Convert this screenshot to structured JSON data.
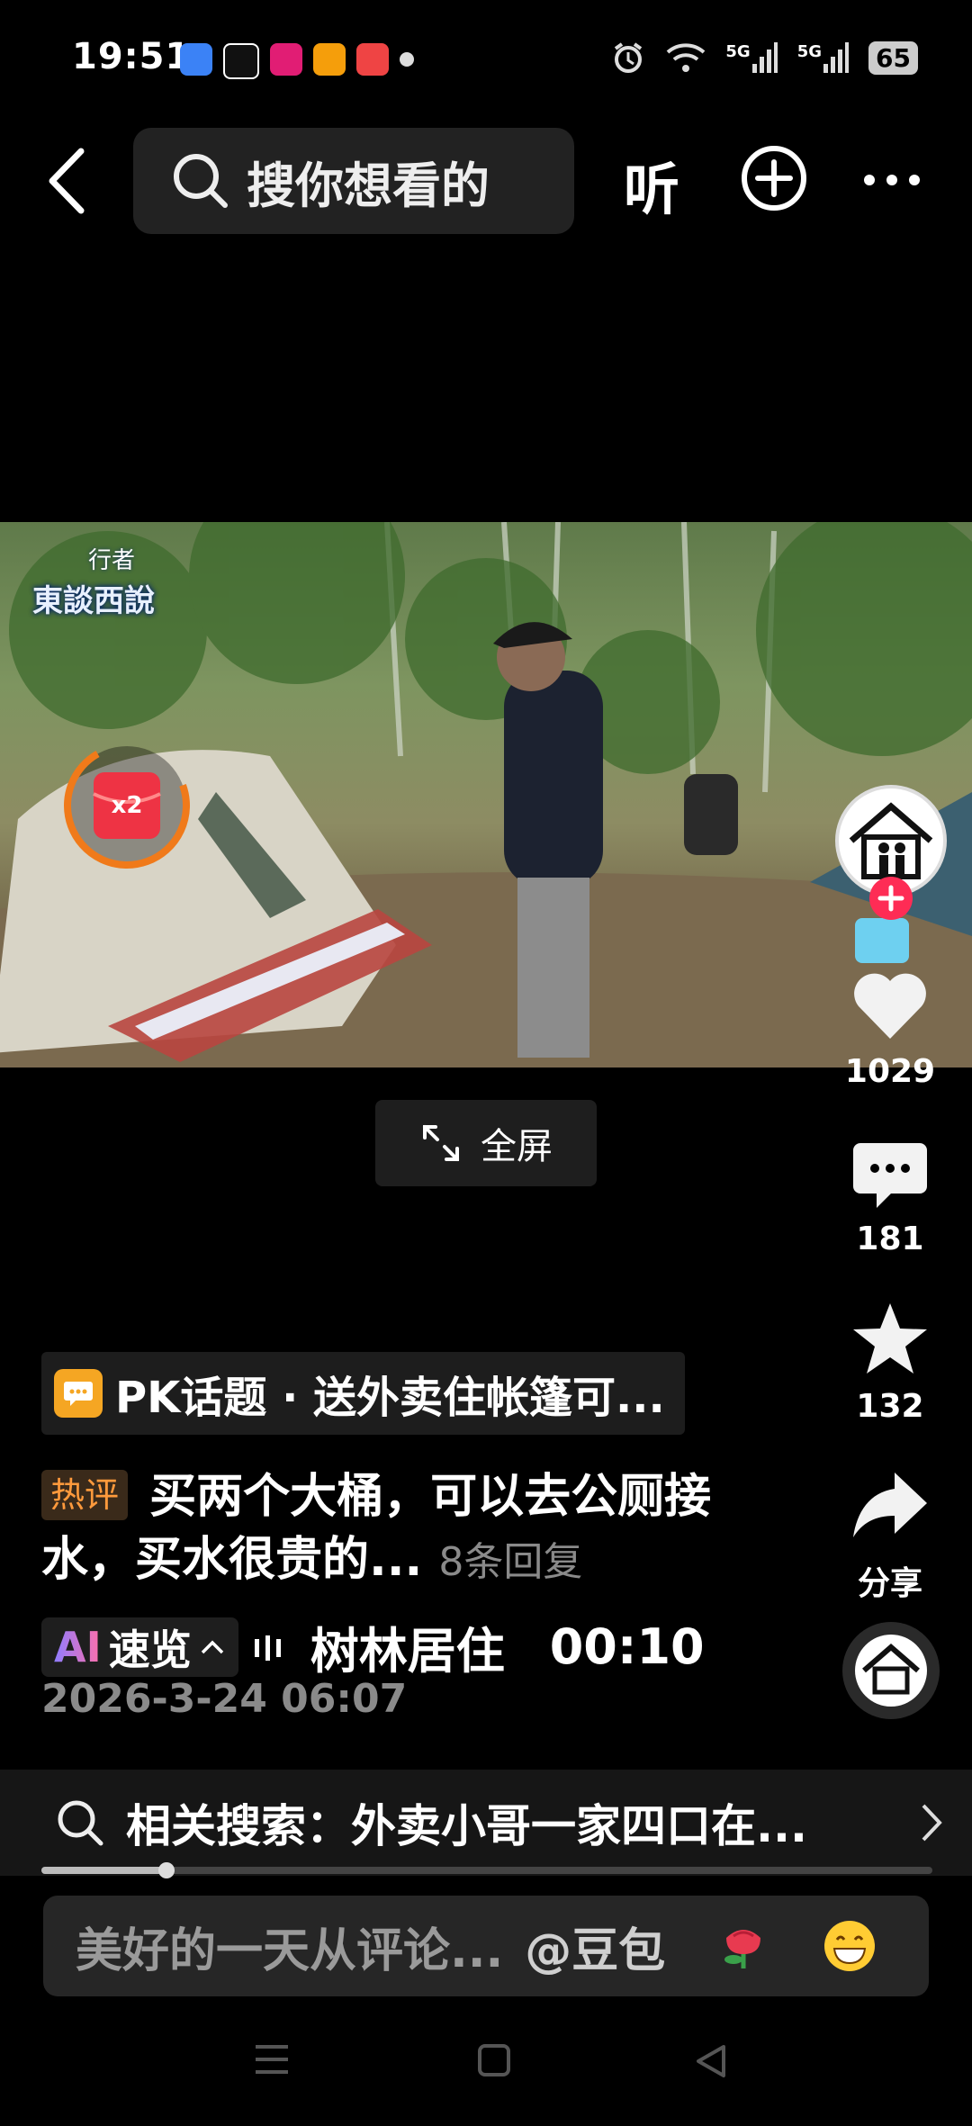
{
  "status_bar": {
    "time": "19:51",
    "battery": "65",
    "net1": "5G",
    "net2": "5G"
  },
  "top_nav": {
    "search_placeholder": "搜你想看的",
    "listen_label": "听"
  },
  "video": {
    "watermark_top": "行者",
    "watermark_main": "東談西說",
    "reward_badge": "x2",
    "fullscreen_label": "全屏"
  },
  "actions": {
    "likes": "1029",
    "comments": "181",
    "favorites": "132",
    "share_label": "分享"
  },
  "caption": {
    "topic": "PK话题 · 送外卖住帐篷可...",
    "hot_tag": "热评",
    "hot_comment": "买两个大桶，可以去公厕接水，买水很贵的...",
    "reply_count": "8条回复",
    "ai_prefix": "AI",
    "ai_label": "速览",
    "ai_summary": "树林居住",
    "ai_time": "00:10",
    "date": "2026-3-24 06:07"
  },
  "related_search": {
    "text": "相关搜索：外卖小哥一家四口在..."
  },
  "playback": {
    "progress": 0.14
  },
  "comment_input": {
    "placeholder": "美好的一天从评论...",
    "mention": "@豆包"
  },
  "colors": {
    "like_heart": "#ffffff",
    "follow_plus": "#fe2c55",
    "hot_tag": "#ff9a3c"
  }
}
